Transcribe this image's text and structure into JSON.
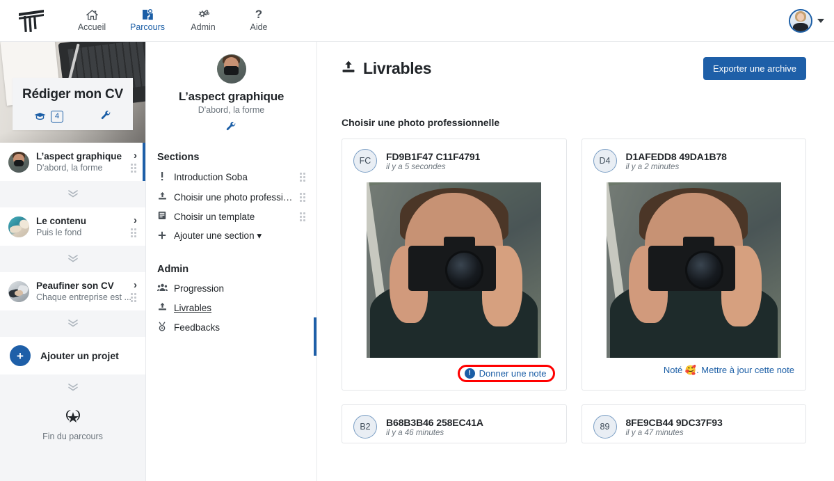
{
  "topnav": {
    "brand_name": "logo-brand",
    "items": [
      {
        "icon": "home-icon",
        "glyph": "⌂",
        "label": "Accueil",
        "active": false
      },
      {
        "icon": "path-icon",
        "glyph": "❖",
        "label": "Parcours",
        "active": true
      },
      {
        "icon": "gears-icon",
        "glyph": "⚙",
        "label": "Admin",
        "active": false
      },
      {
        "icon": "question-icon",
        "glyph": "?",
        "label": "Aide",
        "active": false
      }
    ]
  },
  "left_rail": {
    "hero": {
      "title": "Rédiger mon CV",
      "badge_count": "4",
      "grad_icon": "graduation-cap-icon",
      "wrench_icon": "wrench-icon"
    },
    "items": [
      {
        "title": "L’aspect graphique",
        "subtitle": "D'abord, la forme",
        "active": true
      },
      {
        "title": "Le contenu",
        "subtitle": "Puis le fond",
        "active": false
      },
      {
        "title": "Peaufiner son CV",
        "subtitle": "Chaque entreprise est ...",
        "active": false
      }
    ],
    "add_project_label": "Ajouter un projet",
    "end_label": "Fin du parcours",
    "chevron_glyph": "»",
    "arrow_glyph": "›"
  },
  "mid_panel": {
    "title": "L’aspect graphique",
    "subtitle": "D'abord, la forme",
    "wrench_icon": "wrench-icon",
    "sections_heading": "Sections",
    "sections": [
      {
        "icon": "exclamation-icon",
        "glyph": "❗",
        "label": "Introduction Soba",
        "grip": true,
        "underlined": false
      },
      {
        "icon": "upload-icon",
        "glyph": "⤒",
        "label": "Choisir une photo professio...",
        "grip": true,
        "underlined": false
      },
      {
        "icon": "book-icon",
        "glyph": "▤",
        "label": "Choisir un template",
        "grip": true,
        "underlined": false
      },
      {
        "icon": "plus-icon",
        "glyph": "＋",
        "label": "Ajouter une section ▾",
        "grip": false,
        "underlined": false
      }
    ],
    "admin_heading": "Admin",
    "admin_items": [
      {
        "icon": "users-group-icon",
        "glyph": "♟",
        "label": "Progression",
        "underlined": false
      },
      {
        "icon": "upload-icon",
        "glyph": "⤒",
        "label": "Livrables",
        "underlined": true
      },
      {
        "icon": "medal-icon",
        "glyph": "♁",
        "label": "Feedbacks",
        "underlined": false
      }
    ]
  },
  "main": {
    "title": "Livrables",
    "title_icon": "upload-icon",
    "export_button": "Exporter une archive",
    "section_label": "Choisir une photo professionnelle",
    "cards": [
      {
        "initials": "FC",
        "name": "FD9B1F47 C11F4791",
        "time": "il y a 5 secondes",
        "has_image": true,
        "image_kind": "photographer",
        "footer_text": "Donner une note",
        "footer_kind": "give-note",
        "highlighted": true
      },
      {
        "initials": "D4",
        "name": "D1AFEDD8 49DA1B78",
        "time": "il y a 2 minutes",
        "has_image": true,
        "image_kind": "photographer",
        "footer_text": "Noté 🥰. Mettre à jour cette note",
        "footer_kind": "rated",
        "highlighted": false
      },
      {
        "initials": "B2",
        "name": "B68B3B46 258EC41A",
        "time": "il y a 46 minutes",
        "has_image": false,
        "image_kind": "",
        "footer_text": "",
        "footer_kind": "",
        "highlighted": false
      },
      {
        "initials": "89",
        "name": "8FE9CB44 9DC37F93",
        "time": "il y a 47 minutes",
        "has_image": false,
        "image_kind": "",
        "footer_text": "",
        "footer_kind": "",
        "highlighted": false
      }
    ]
  },
  "colors": {
    "accent": "#1e5fa8",
    "link": "#1b5ea6",
    "highlight": "#ff0000",
    "muted": "#6c757d",
    "panel_bg": "#f4f5f7"
  }
}
